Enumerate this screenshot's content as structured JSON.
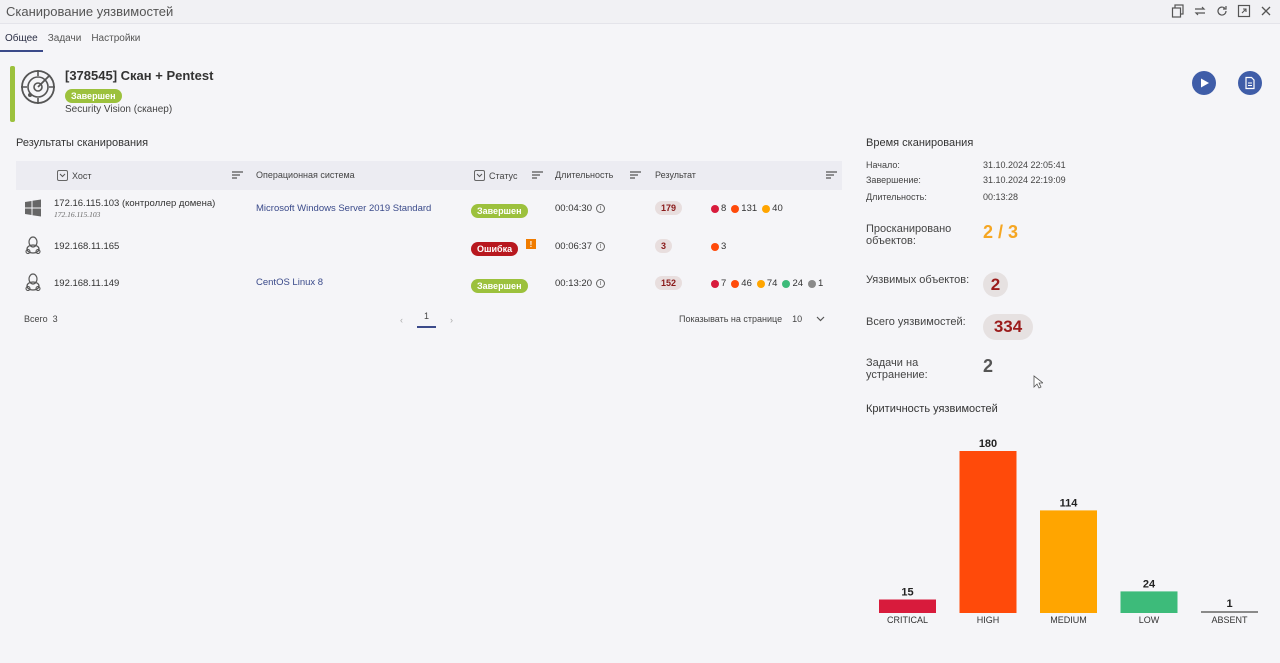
{
  "window": {
    "title": "Сканирование уязвимостей"
  },
  "tabs": [
    {
      "label": "Общее"
    },
    {
      "label": "Задачи"
    },
    {
      "label": "Настройки"
    }
  ],
  "job": {
    "title": "[378545] Скан + Pentest",
    "status": "Завершен",
    "scanner": "Security Vision (сканер)"
  },
  "results": {
    "title": "Результаты сканирования",
    "columns": {
      "host": "Хост",
      "os": "Операционная система",
      "status": "Статус",
      "duration": "Длительность",
      "result": "Результат"
    },
    "rows": [
      {
        "host": "172.16.115.103 (контроллер домена)",
        "host_sub": "172.16.115.103",
        "os": "Microsoft Windows Server 2019 Standard",
        "os_icon": "windows-icon",
        "status": "Завершен",
        "duration": "00:04:30",
        "total": "179",
        "sev": [
          "8",
          "131",
          "40"
        ]
      },
      {
        "host": "192.168.11.165",
        "os": "",
        "os_icon": "linux-icon",
        "status": "Ошибка",
        "warn": "!",
        "duration": "00:06:37",
        "total": "3",
        "sev": [
          "3"
        ]
      },
      {
        "host": "192.168.11.149",
        "os": "CentOS Linux 8",
        "os_icon": "linux-icon",
        "status": "Завершен",
        "duration": "00:13:20",
        "total": "152",
        "sev": [
          "7",
          "46",
          "74",
          "24",
          "1"
        ]
      }
    ],
    "total_label": "Всего",
    "total_value": "3",
    "page": "1",
    "per_page_label": "Показывать на странице",
    "per_page_value": "10"
  },
  "time": {
    "title": "Время сканирования",
    "start_label": "Начало:",
    "start": "31.10.2024 22:05:41",
    "end_label": "Завершение:",
    "end": "31.10.2024 22:19:09",
    "duration_label": "Длительность:",
    "duration": "00:13:28"
  },
  "stats": {
    "scanned_label_1": "Просканировано",
    "scanned_label_2": "объектов:",
    "scanned": "2 / 3",
    "vulnerable_label": "Уязвимых объектов:",
    "vulnerable": "2",
    "total_vuln_label": "Всего уязвимостей:",
    "total_vuln": "334",
    "tasks_label_1": "Задачи на",
    "tasks_label_2": "устранение:",
    "tasks": "2"
  },
  "colors": {
    "critical": "#d81b3c",
    "high": "#ff4a0a",
    "medium": "#ffa500",
    "low": "#3dbb7a",
    "absent": "#8a8a8a",
    "green": "#9cc13d",
    "red": "#b8181f"
  },
  "chart_title": "Критичность уязвимостей",
  "chart_data": {
    "type": "bar",
    "categories": [
      "CRITICAL",
      "HIGH",
      "MEDIUM",
      "LOW",
      "ABSENT"
    ],
    "values": [
      15,
      180,
      114,
      24,
      1
    ],
    "colors": [
      "#d81b3c",
      "#ff4a0a",
      "#ffa500",
      "#3dbb7a",
      "#8a8a8a"
    ],
    "title": "",
    "xlabel": "",
    "ylabel": "",
    "ylim": [
      0,
      180
    ],
    "grid": false
  }
}
